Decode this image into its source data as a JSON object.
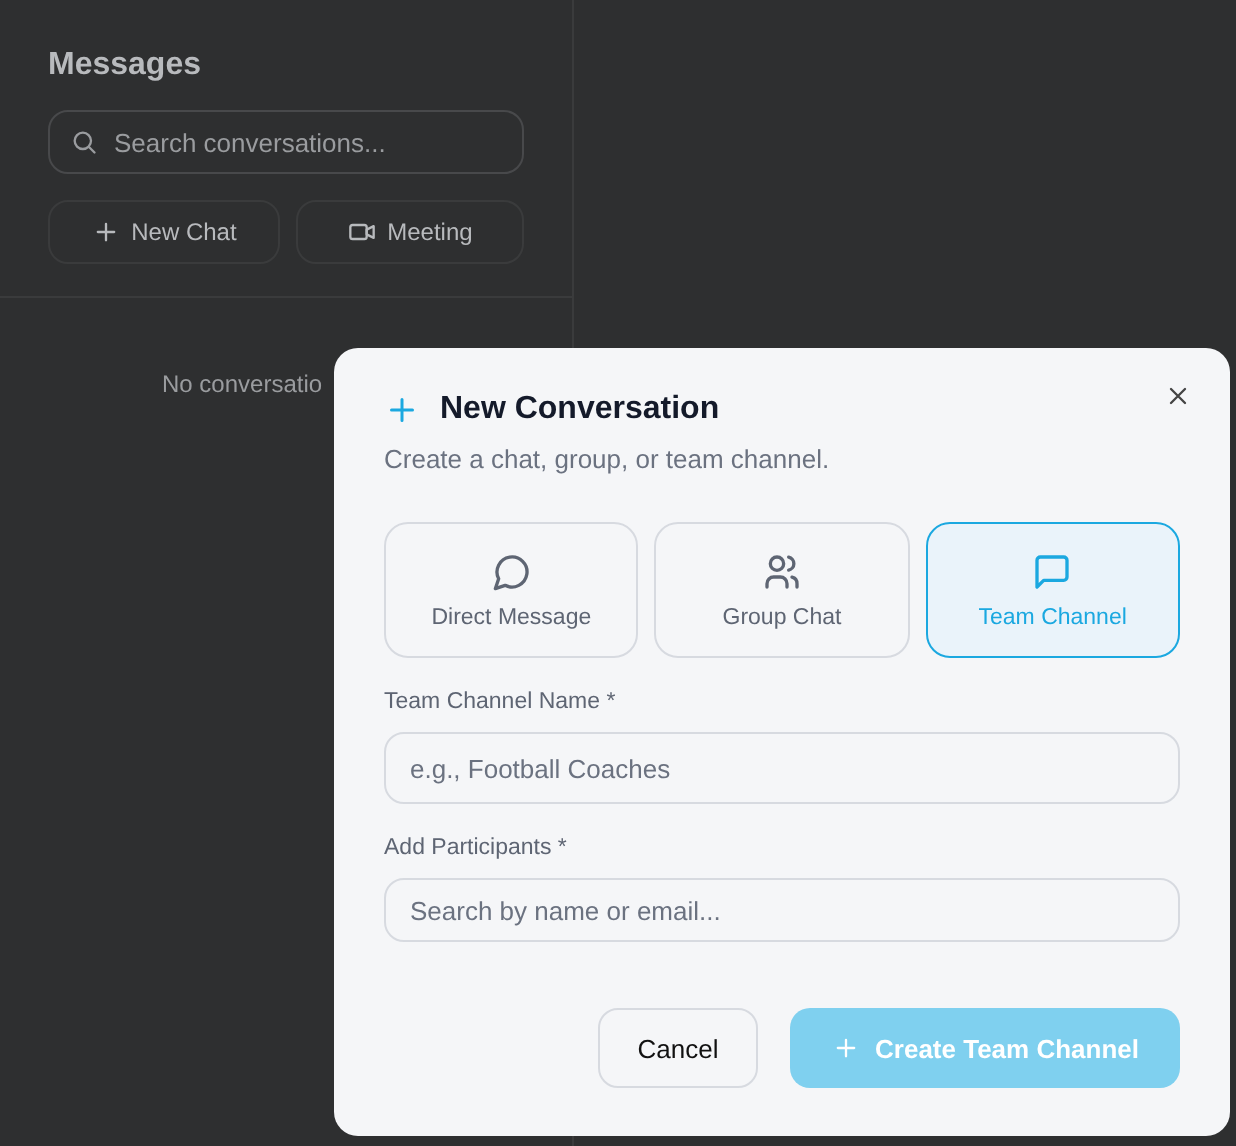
{
  "sidebar": {
    "title": "Messages",
    "search": {
      "placeholder": "Search conversations..."
    },
    "actions": [
      {
        "kind": "plus",
        "label": "New Chat"
      },
      {
        "kind": "video",
        "label": "Meeting"
      }
    ],
    "empty_text": "No conversatio"
  },
  "dialog": {
    "title": "New Conversation",
    "subtitle": "Create a chat, group, or team channel.",
    "types": [
      {
        "kind": "bubble",
        "label": "Direct Message",
        "selected": false
      },
      {
        "kind": "people",
        "label": "Group Chat",
        "selected": false
      },
      {
        "kind": "square",
        "label": "Team Channel",
        "selected": true
      }
    ],
    "fields": [
      {
        "label": "Team Channel Name *",
        "placeholder": "e.g., Football Coaches"
      },
      {
        "label": "Add Participants *",
        "placeholder": "Search by name or email..."
      }
    ],
    "cancel": "Cancel",
    "submit": {
      "label": "Create Team Channel",
      "disabled": true
    }
  }
}
